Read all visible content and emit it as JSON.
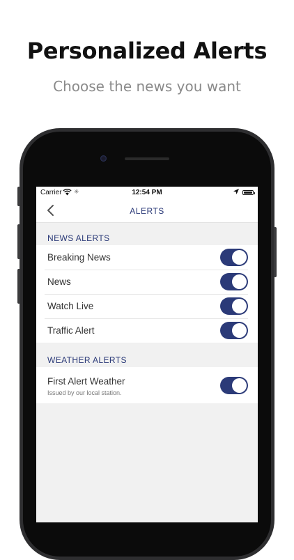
{
  "promo": {
    "title": "Personalized Alerts",
    "subtitle": "Choose the news you want"
  },
  "status_bar": {
    "carrier": "Carrier",
    "time": "12:54 PM"
  },
  "nav": {
    "title": "ALERTS"
  },
  "news_alerts": {
    "header": "NEWS ALERTS",
    "items": [
      {
        "label": "Breaking News",
        "enabled": true
      },
      {
        "label": "News",
        "enabled": true
      },
      {
        "label": "Watch Live",
        "enabled": true
      },
      {
        "label": "Traffic Alert",
        "enabled": true
      }
    ]
  },
  "weather_alerts": {
    "header": "WEATHER ALERTS",
    "items": [
      {
        "label": "First Alert Weather",
        "sublabel": "Issued by our local station.",
        "enabled": true
      }
    ]
  },
  "colors": {
    "accent": "#2b3a78",
    "background": "#f1f1f1"
  }
}
